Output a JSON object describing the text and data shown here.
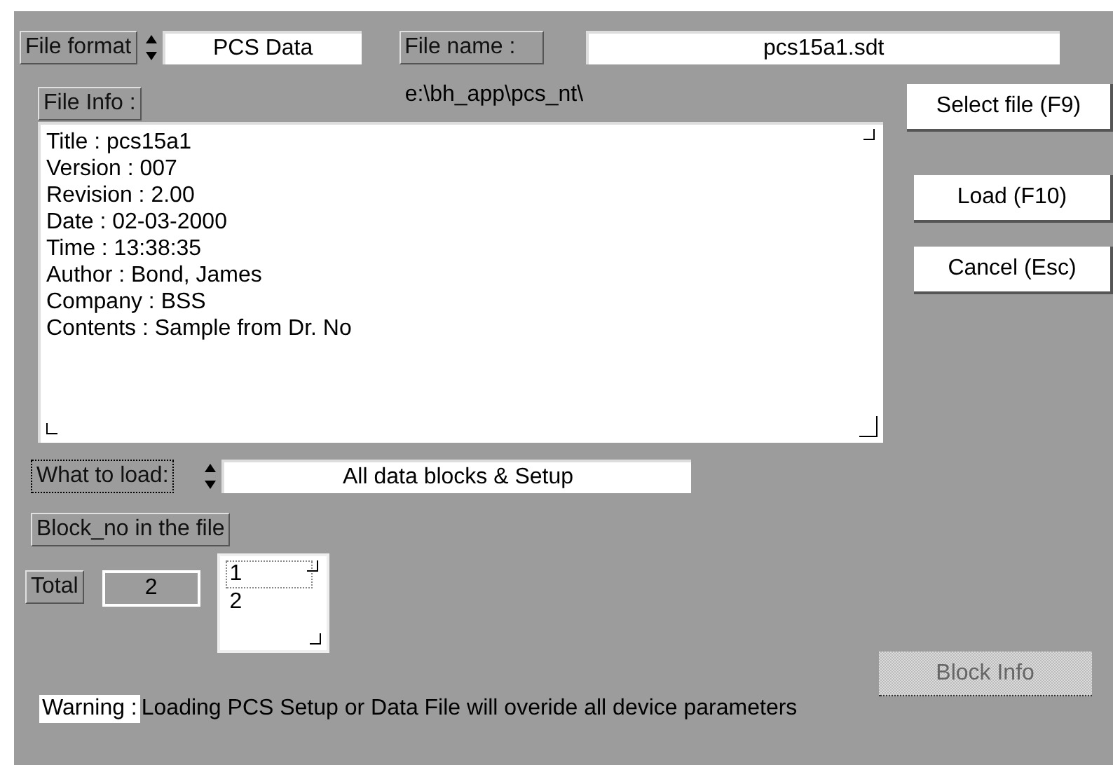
{
  "file_format": {
    "label": "File format",
    "value": "PCS Data"
  },
  "file_name": {
    "label": "File name :",
    "value": "pcs15a1.sdt"
  },
  "file_info": {
    "label": "File Info :",
    "path": "e:\\bh_app\\pcs_nt\\",
    "lines": [
      "Title : pcs15a1",
      "Version : 007",
      "Revision : 2.00",
      "Date : 02-03-2000",
      "Time : 13:38:35",
      "Author : Bond, James",
      "Company : BSS",
      "Contents : Sample from Dr. No"
    ]
  },
  "buttons": [
    {
      "label": "Select file (F9)",
      "disabled": false
    },
    {
      "label": "Load (F10)",
      "disabled": false
    },
    {
      "label": "Cancel (Esc)",
      "disabled": false
    }
  ],
  "what_to_load": {
    "label": "What to load:",
    "focused": true,
    "value": "All data blocks & Setup"
  },
  "block_no": {
    "label": "Block_no in the file",
    "total_label": "Total",
    "total": "2",
    "items": [
      {
        "text": "1",
        "focused": true
      },
      {
        "text": "2",
        "focused": false
      }
    ]
  },
  "block_info_button": {
    "label": "Block Info",
    "disabled": true
  },
  "warning": {
    "label": "Warning :",
    "text": "Loading PCS Setup or Data File will overide all device parameters"
  }
}
